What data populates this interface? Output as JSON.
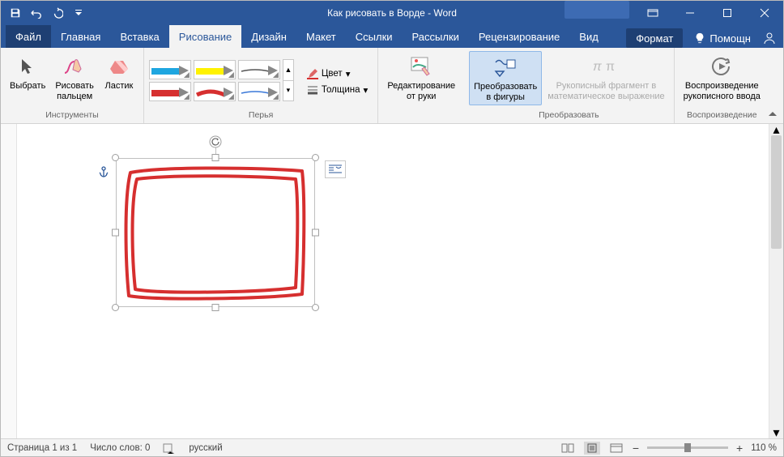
{
  "title": "Как рисовать в Ворде  -  Word",
  "tabs": {
    "file": "Файл",
    "items": [
      "Главная",
      "Вставка",
      "Рисование",
      "Дизайн",
      "Макет",
      "Ссылки",
      "Рассылки",
      "Рецензирование",
      "Вид"
    ],
    "active": "Рисование",
    "format": "Формат"
  },
  "help": "Помощн",
  "ribbon": {
    "tools": {
      "label": "Инструменты",
      "select": "Выбрать",
      "finger": "Рисовать\nпальцем",
      "eraser": "Ластик"
    },
    "pens": {
      "label": "Перья",
      "color": "Цвет",
      "thickness": "Толщина"
    },
    "edit_ink": {
      "label1": "Редактирование",
      "label2": "от руки"
    },
    "convert": {
      "shapes1": "Преобразовать",
      "shapes2": "в фигуры",
      "math1": "Рукописный фрагмент в",
      "math2": "математическое выражение",
      "group": "Преобразовать"
    },
    "replay": {
      "label1": "Воспроизведение",
      "label2": "рукописного ввода",
      "group": "Воспроизведение"
    }
  },
  "status": {
    "page": "Страница 1 из 1",
    "words": "Число слов: 0",
    "lang": "русский",
    "zoom": "110 %"
  },
  "ink": {
    "color": "#d62f2f"
  }
}
